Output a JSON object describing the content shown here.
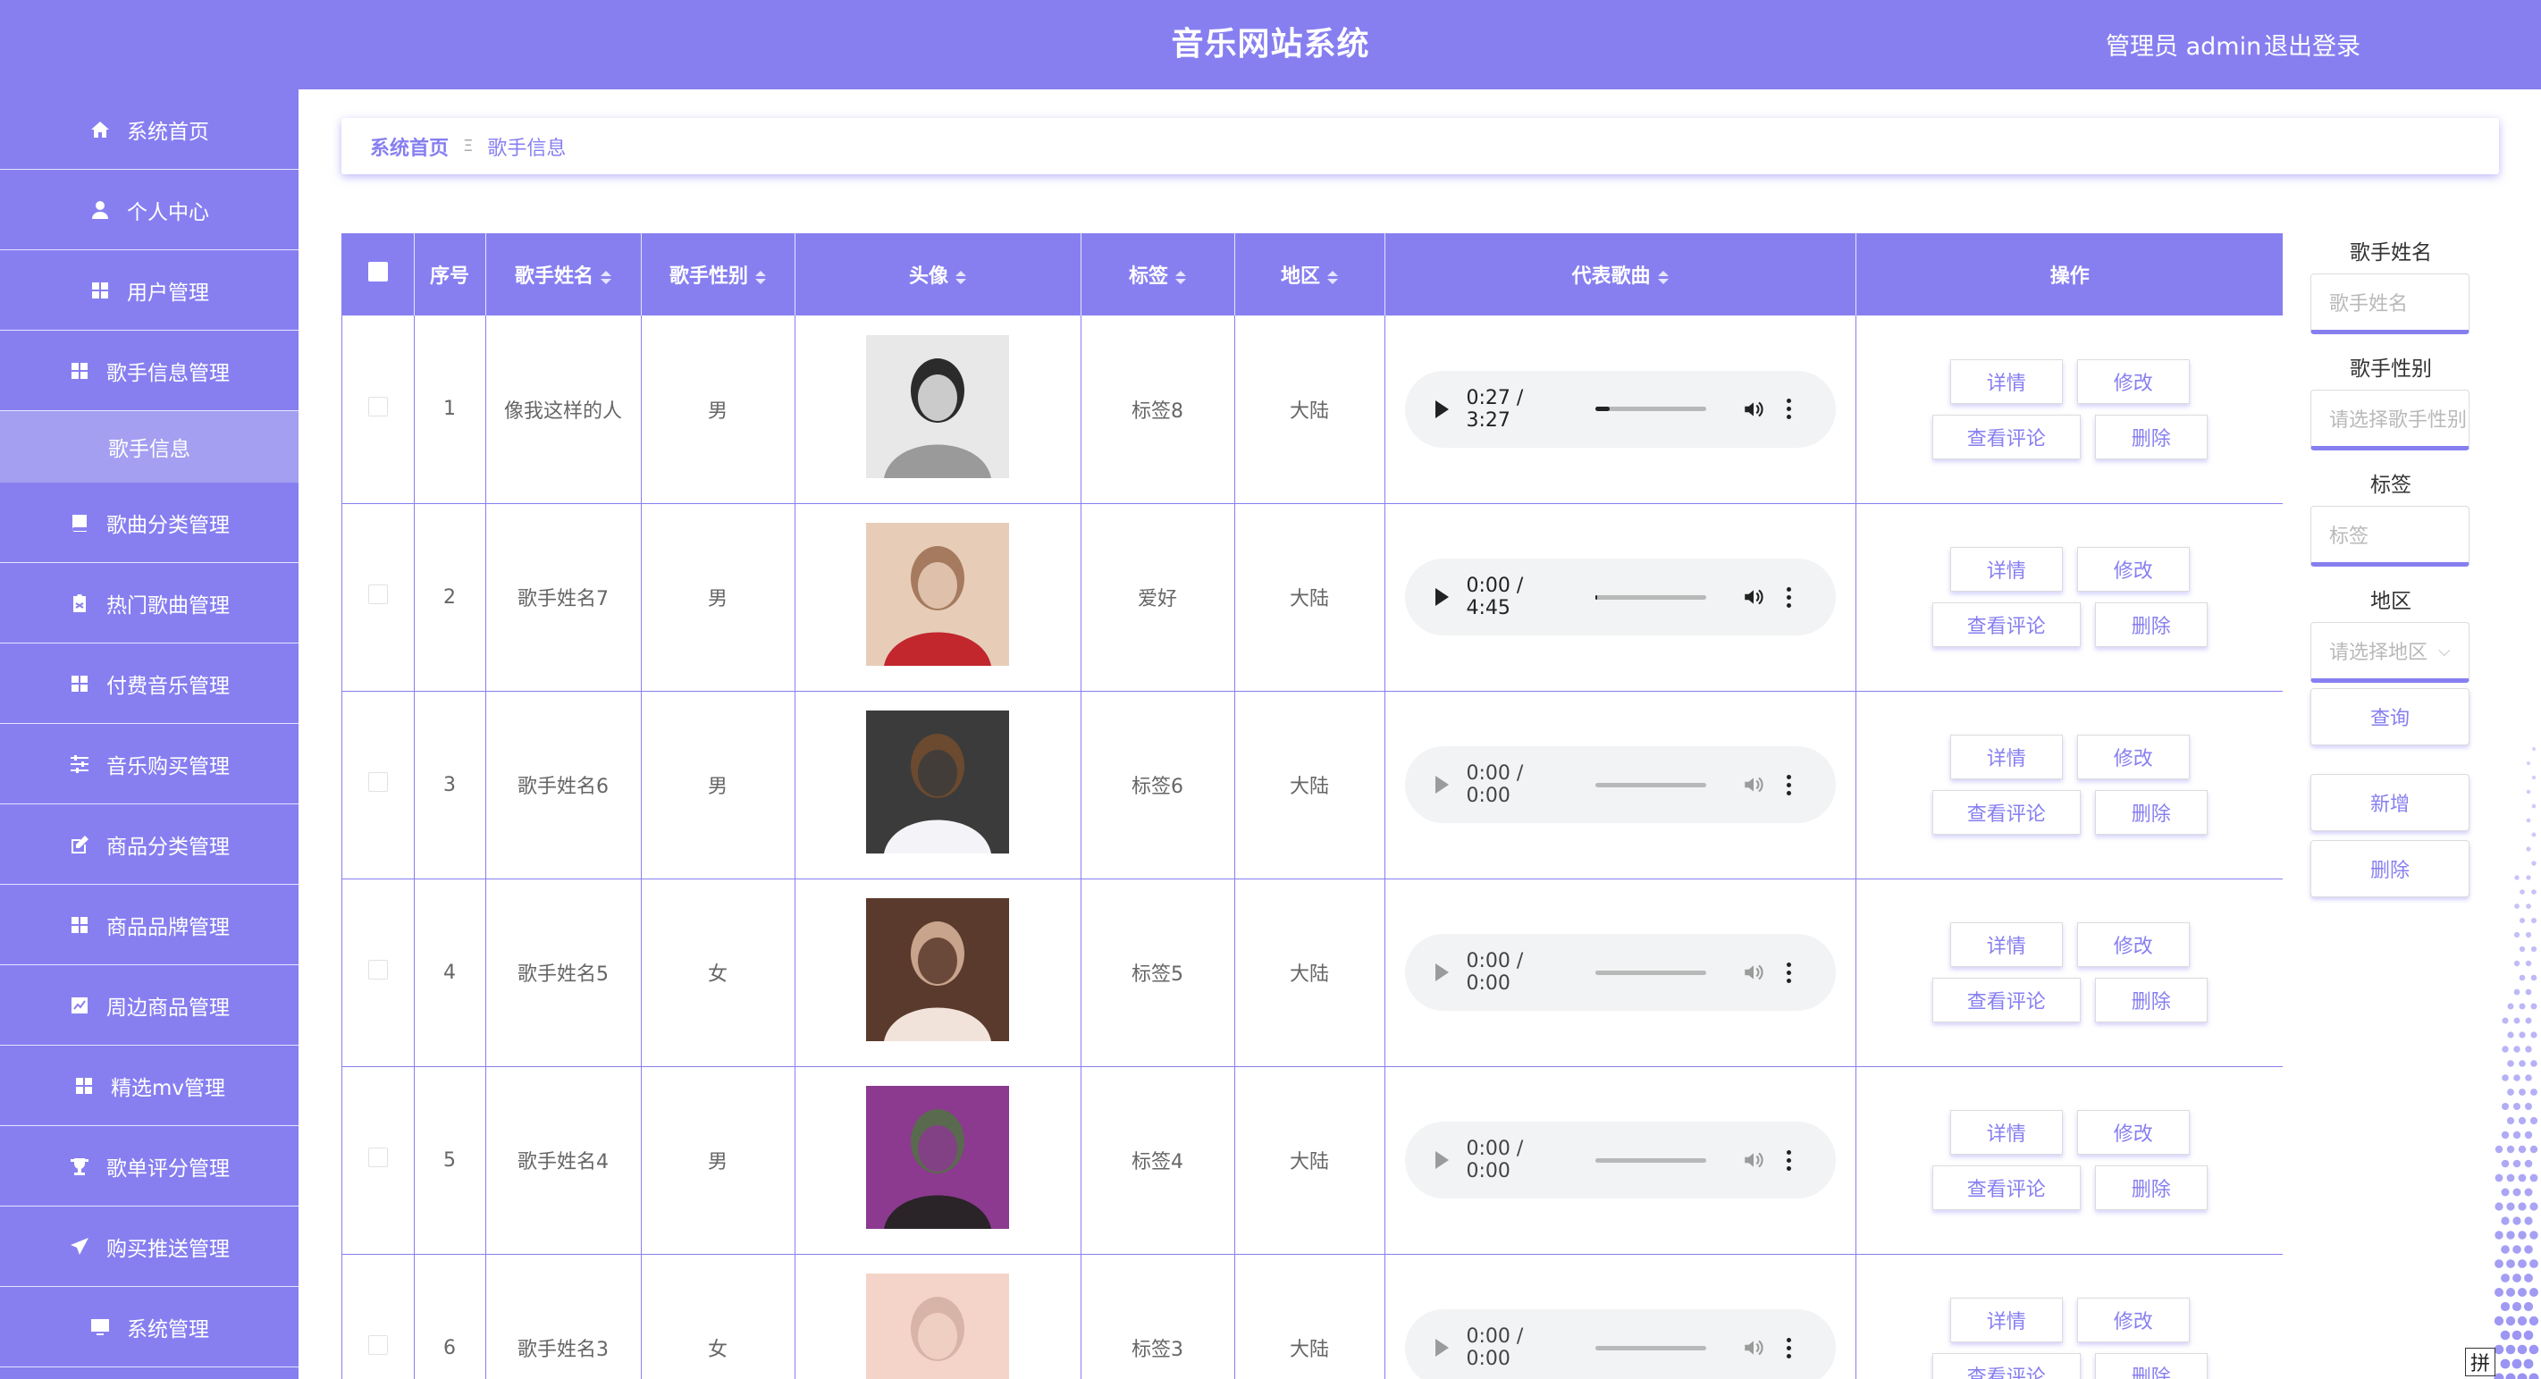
{
  "header": {
    "title": "音乐网站系统",
    "user": "管理员 admin",
    "logout": "退出登录"
  },
  "sidebar": {
    "items": [
      {
        "label": "系统首页",
        "icon": "home-icon"
      },
      {
        "label": "个人中心",
        "icon": "user-icon"
      },
      {
        "label": "用户管理",
        "icon": "grid-icon"
      },
      {
        "label": "歌手信息管理",
        "icon": "grid-icon"
      },
      {
        "label": "歌手信息",
        "icon": ""
      },
      {
        "label": "歌曲分类管理",
        "icon": "book-icon"
      },
      {
        "label": "热门歌曲管理",
        "icon": "clipboard-icon"
      },
      {
        "label": "付费音乐管理",
        "icon": "grid-icon"
      },
      {
        "label": "音乐购买管理",
        "icon": "sliders-icon"
      },
      {
        "label": "商品分类管理",
        "icon": "edit-icon"
      },
      {
        "label": "商品品牌管理",
        "icon": "grid-icon"
      },
      {
        "label": "周边商品管理",
        "icon": "chart-icon"
      },
      {
        "label": "精选mv管理",
        "icon": "grid-icon"
      },
      {
        "label": "歌单评分管理",
        "icon": "trophy-icon"
      },
      {
        "label": "购买推送管理",
        "icon": "send-icon"
      },
      {
        "label": "系统管理",
        "icon": "monitor-icon"
      }
    ]
  },
  "breadcrumb": {
    "home": "系统首页",
    "separator": "Ξ",
    "current": "歌手信息"
  },
  "table": {
    "headers": {
      "index": "序号",
      "name": "歌手姓名",
      "gender": "歌手性别",
      "avatar": "头像",
      "tag": "标签",
      "region": "地区",
      "song": "代表歌曲",
      "ops": "操作"
    },
    "actions": {
      "detail": "详情",
      "edit": "修改",
      "comments": "查看评论",
      "delete": "删除"
    },
    "rows": [
      {
        "index": "1",
        "name": "像我这样的人",
        "gender": "男",
        "tag": "标签8",
        "region": "大陆",
        "time": "0:27 / 3:27",
        "progress": 0.13,
        "enabled": true
      },
      {
        "index": "2",
        "name": "歌手姓名7",
        "gender": "男",
        "tag": "爱好",
        "region": "大陆",
        "time": "0:00 / 4:45",
        "progress": 0.02,
        "enabled": true
      },
      {
        "index": "3",
        "name": "歌手姓名6",
        "gender": "男",
        "tag": "标签6",
        "region": "大陆",
        "time": "0:00 / 0:00",
        "progress": 0,
        "enabled": false
      },
      {
        "index": "4",
        "name": "歌手姓名5",
        "gender": "女",
        "tag": "标签5",
        "region": "大陆",
        "time": "0:00 / 0:00",
        "progress": 0,
        "enabled": false
      },
      {
        "index": "5",
        "name": "歌手姓名4",
        "gender": "男",
        "tag": "标签4",
        "region": "大陆",
        "time": "0:00 / 0:00",
        "progress": 0,
        "enabled": false
      },
      {
        "index": "6",
        "name": "歌手姓名3",
        "gender": "女",
        "tag": "标签3",
        "region": "大陆",
        "time": "0:00 / 0:00",
        "progress": 0,
        "enabled": false
      }
    ]
  },
  "search": {
    "name_label": "歌手姓名",
    "name_placeholder": "歌手姓名",
    "gender_label": "歌手性别",
    "gender_placeholder": "请选择歌手性别",
    "tag_label": "标签",
    "tag_placeholder": "标签",
    "region_label": "地区",
    "region_placeholder": "请选择地区",
    "query": "查询",
    "add": "新增",
    "delete": "删除"
  },
  "ime": {
    "label": "拼"
  },
  "colors": {
    "accent": "#877ff0",
    "accent_light": "#a49ff0",
    "border": "#dcdcdc"
  }
}
